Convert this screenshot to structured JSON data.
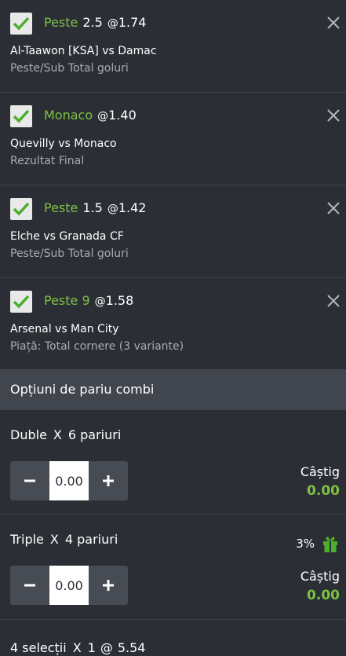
{
  "selections": [
    {
      "pick": "Peste",
      "line": "2.5",
      "at": "@",
      "odds": "1.74",
      "match": "Al-Taawon [KSA] vs Damac",
      "market": "Peste/Sub Total goluri"
    },
    {
      "pick": "Monaco",
      "line": "",
      "at": "@",
      "odds": "1.40",
      "match": "Quevilly vs Monaco",
      "market": "Rezultat Final"
    },
    {
      "pick": "Peste",
      "line": "1.5",
      "at": "@",
      "odds": "1.42",
      "match": "Elche vs Granada CF",
      "market": "Peste/Sub Total goluri"
    },
    {
      "pick": "Peste 9",
      "line": "",
      "at": "@",
      "odds": "1.58",
      "match": "Arsenal vs Man City",
      "market": "Piață: Total cornere (3 variante)"
    }
  ],
  "combi": {
    "header": "Opțiuni de pariu combi",
    "doubles": {
      "type": "Duble",
      "x": "X",
      "count": "6 pariuri",
      "stake": "0.00",
      "win_label": "Câștig",
      "win_value": "0.00"
    },
    "triples": {
      "type": "Triple",
      "x": "X",
      "count": "4 pariuri",
      "bonus": "3%",
      "stake": "0.00",
      "win_label": "Câștig",
      "win_value": "0.00"
    },
    "fourfold": {
      "type": "4 selecții",
      "x": "X",
      "count": "1",
      "at": "@",
      "odds": "5.54"
    }
  },
  "colors": {
    "accent_green": "#7cc142",
    "background": "#2b2f35",
    "header_bg": "#41464e"
  },
  "icons": {
    "check": "check-icon",
    "close": "close-icon",
    "minus": "minus-icon",
    "plus": "plus-icon",
    "gift": "gift-icon"
  }
}
